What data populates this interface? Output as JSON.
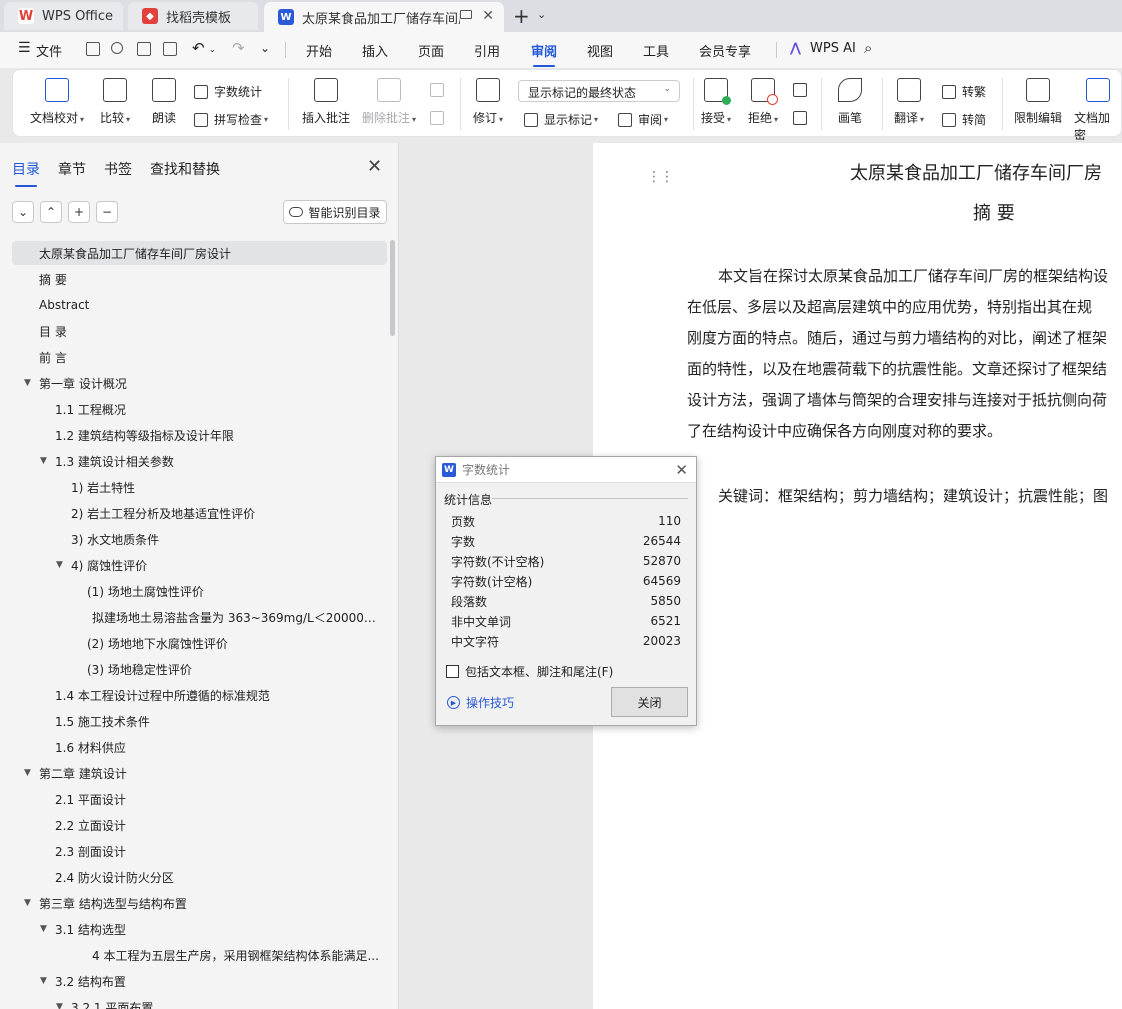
{
  "tabs": [
    {
      "label": "WPS Office",
      "icon": "wps-logo-icon"
    },
    {
      "label": "找稻壳模板",
      "icon": "docer-icon"
    },
    {
      "label": "太原某食品加工厂储存车间厂房",
      "icon": "word-doc-icon"
    }
  ],
  "menu": {
    "file": "文件",
    "items": [
      "开始",
      "插入",
      "页面",
      "引用",
      "审阅",
      "视图",
      "工具",
      "会员专享"
    ],
    "active": "审阅",
    "ai": "WPS AI"
  },
  "ribbon": {
    "proofread": "文档校对",
    "compare": "比较",
    "read_aloud": "朗读",
    "word_count": "字数统计",
    "spell_check": "拼写检查",
    "insert_comment": "插入批注",
    "delete_comment": "删除批注",
    "track_changes": "修订",
    "markup_state": "显示标记的最终状态",
    "show_markup": "显示标记",
    "review": "审阅",
    "accept": "接受",
    "reject": "拒绝",
    "pen": "画笔",
    "translate": "翻译",
    "to_traditional": "转繁",
    "to_simplified": "转简",
    "restrict_editing": "限制编辑",
    "encrypt": "文档加密"
  },
  "nav": {
    "tabs": [
      "目录",
      "章节",
      "书签",
      "查找和替换"
    ],
    "smart_toc": "智能识别目录",
    "toc": [
      {
        "text": "太原某食品加工厂储存车间厂房设计",
        "level": 0,
        "arrow": false,
        "selected": true
      },
      {
        "text": "摘  要",
        "level": 0,
        "arrow": false
      },
      {
        "text": "Abstract",
        "level": 0,
        "arrow": false
      },
      {
        "text": "目  录",
        "level": 0,
        "arrow": false
      },
      {
        "text": "前  言",
        "level": 0,
        "arrow": false
      },
      {
        "text": "第一章  设计概况",
        "level": 0,
        "arrow": true
      },
      {
        "text": "1.1  工程概况",
        "level": 1,
        "arrow": false
      },
      {
        "text": "1.2  建筑结构等级指标及设计年限",
        "level": 1,
        "arrow": false
      },
      {
        "text": "1.3  建筑设计相关参数",
        "level": 1,
        "arrow": true
      },
      {
        "text": "1)  岩土特性",
        "level": 2,
        "arrow": false
      },
      {
        "text": "2)  岩土工程分析及地基适宜性评价",
        "level": 2,
        "arrow": false
      },
      {
        "text": "3)  水文地质条件",
        "level": 2,
        "arrow": false
      },
      {
        "text": "4)  腐蚀性评价",
        "level": 2,
        "arrow": true
      },
      {
        "text": "(1)  场地土腐蚀性评价",
        "level": 3,
        "arrow": false
      },
      {
        "text": "拟建场地土易溶盐含量为 363~369mg/L＜20000。...",
        "level": 4,
        "arrow": false
      },
      {
        "text": "(2)  场地地下水腐蚀性评价",
        "level": 3,
        "arrow": false
      },
      {
        "text": "(3)  场地稳定性评价",
        "level": 3,
        "arrow": false
      },
      {
        "text": "1.4  本工程设计过程中所遵循的标准规范",
        "level": 1,
        "arrow": false
      },
      {
        "text": "1.5  施工技术条件",
        "level": 1,
        "arrow": false
      },
      {
        "text": "1.6  材料供应",
        "level": 1,
        "arrow": false
      },
      {
        "text": "第二章  建筑设计",
        "level": 0,
        "arrow": true
      },
      {
        "text": "2.1  平面设计",
        "level": 1,
        "arrow": false
      },
      {
        "text": "2.2  立面设计",
        "level": 1,
        "arrow": false
      },
      {
        "text": "2.3  剖面设计",
        "level": 1,
        "arrow": false
      },
      {
        "text": "2.4  防火设计防火分区",
        "level": 1,
        "arrow": false
      },
      {
        "text": "第三章  结构选型与结构布置",
        "level": 0,
        "arrow": true
      },
      {
        "text": "3.1  结构选型",
        "level": 1,
        "arrow": true
      },
      {
        "text": "4 本工程为五层生产房，采用钢框架结构体系能满足...",
        "level": 4,
        "arrow": false
      },
      {
        "text": "3.2  结构布置",
        "level": 1,
        "arrow": true
      },
      {
        "text": "3.2.1  平面布置",
        "level": 2,
        "arrow": true
      }
    ]
  },
  "document": {
    "title": "太原某食品加工厂储存车间厂房",
    "heading": "摘  要",
    "lines": [
      "本文旨在探讨太原某食品加工厂储存车间厂房的框架结构设",
      "在低层、多层以及超高层建筑中的应用优势，特别指出其在规",
      "刚度方面的特点。随后，通过与剪力墙结构的对比，阐述了框架",
      "面的特性，以及在地震荷载下的抗震性能。文章还探讨了框架结",
      "设计方法，强调了墙体与筒架的合理安排与连接对于抵抗侧向荷",
      "了在结构设计中应确保各方向刚度对称的要求。"
    ],
    "keywords": "关键词：框架结构；剪力墙结构；建筑设计；抗震性能；图"
  },
  "word_count": {
    "title": "字数统计",
    "section": "统计信息",
    "rows": [
      {
        "label": "页数",
        "value": "110"
      },
      {
        "label": "字数",
        "value": "26544"
      },
      {
        "label": "字符数(不计空格)",
        "value": "52870"
      },
      {
        "label": "字符数(计空格)",
        "value": "64569"
      },
      {
        "label": "段落数",
        "value": "5850"
      },
      {
        "label": "非中文单词",
        "value": "6521"
      },
      {
        "label": "中文字符",
        "value": "20023"
      }
    ],
    "include_checkbox": "包括文本框、脚注和尾注(F)",
    "tips": "操作技巧",
    "close_button": "关闭"
  },
  "colors": {
    "accent": "#2257d8",
    "wps_red": "#e0413a",
    "word_blue": "#2a5ad7"
  }
}
